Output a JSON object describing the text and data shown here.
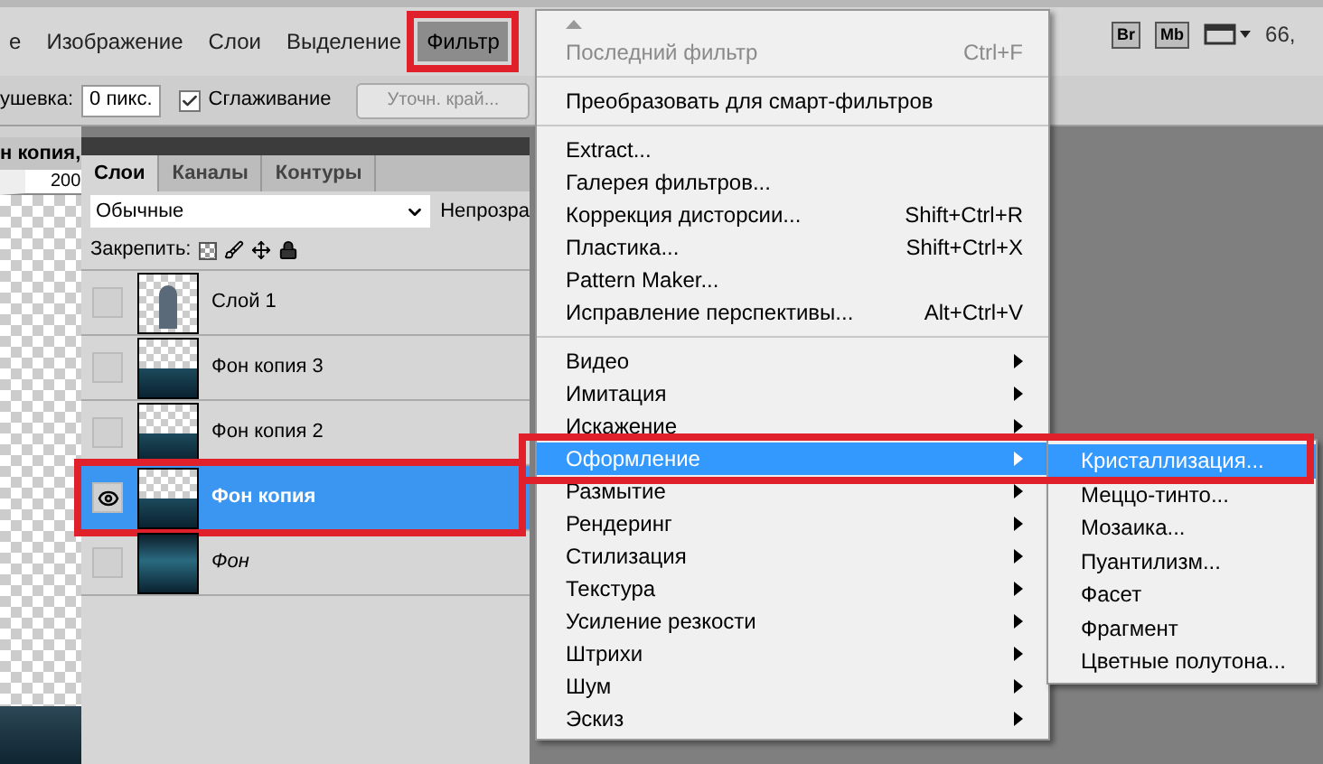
{
  "menubar": {
    "items": [
      {
        "label": "е",
        "selected": false
      },
      {
        "label": "Изображение",
        "selected": false
      },
      {
        "label": "Слои",
        "selected": false
      },
      {
        "label": "Выделение",
        "selected": false
      },
      {
        "label": "Фильтр",
        "selected": true
      }
    ],
    "app_buttons": [
      "Br",
      "Mb"
    ],
    "zoom": "66,"
  },
  "options_bar": {
    "feather_label": "ушевка:",
    "feather_value": "0 пикс.",
    "antialias": {
      "label": "Сглаживание",
      "checked": true
    },
    "refine_button": "Уточн. край..."
  },
  "document": {
    "tab": "н копия,",
    "ruler_mark": "200"
  },
  "layers_panel": {
    "tabs": [
      {
        "label": "Слои",
        "selected": true
      },
      {
        "label": "Каналы",
        "selected": false
      },
      {
        "label": "Контуры",
        "selected": false
      }
    ],
    "blend_mode": "Обычные",
    "opacity_label": "Непрозра",
    "lock_label": "Закрепить:",
    "layers": [
      {
        "name": "Слой 1",
        "kind": "figure",
        "visible": false,
        "selected": false
      },
      {
        "name": "Фон копия 3",
        "kind": "copy",
        "visible": false,
        "selected": false
      },
      {
        "name": "Фон копия 2",
        "kind": "copy",
        "visible": false,
        "selected": false
      },
      {
        "name": "Фон копия",
        "kind": "copy",
        "visible": true,
        "selected": true
      },
      {
        "name": "Фон",
        "kind": "background",
        "visible": false,
        "selected": false
      }
    ]
  },
  "filter_menu": {
    "sections": [
      [
        {
          "label": "Последний фильтр",
          "shortcut": "Ctrl+F",
          "disabled": true,
          "submenu": false,
          "selected": false
        }
      ],
      [
        {
          "label": "Преобразовать для смарт-фильтров",
          "disabled": false,
          "submenu": false,
          "selected": false
        }
      ],
      [
        {
          "label": "Extract...",
          "disabled": false,
          "submenu": false,
          "selected": false
        },
        {
          "label": "Галерея фильтров...",
          "disabled": false,
          "submenu": false,
          "selected": false
        },
        {
          "label": "Коррекция дисторсии...",
          "shortcut": "Shift+Ctrl+R",
          "disabled": false,
          "submenu": false,
          "selected": false
        },
        {
          "label": "Пластика...",
          "shortcut": "Shift+Ctrl+X",
          "disabled": false,
          "submenu": false,
          "selected": false
        },
        {
          "label": "Pattern Maker...",
          "disabled": false,
          "submenu": false,
          "selected": false
        },
        {
          "label": "Исправление перспективы...",
          "shortcut": "Alt+Ctrl+V",
          "disabled": false,
          "submenu": false,
          "selected": false
        }
      ],
      [
        {
          "label": "Видео",
          "disabled": false,
          "submenu": true,
          "selected": false
        },
        {
          "label": "Имитация",
          "disabled": false,
          "submenu": true,
          "selected": false
        },
        {
          "label": "Искажение",
          "disabled": false,
          "submenu": true,
          "selected": false
        },
        {
          "label": "Оформление",
          "disabled": false,
          "submenu": true,
          "selected": true
        },
        {
          "label": "Размытие",
          "disabled": false,
          "submenu": true,
          "selected": false
        },
        {
          "label": "Рендеринг",
          "disabled": false,
          "submenu": true,
          "selected": false
        },
        {
          "label": "Стилизация",
          "disabled": false,
          "submenu": true,
          "selected": false
        },
        {
          "label": "Текстура",
          "disabled": false,
          "submenu": true,
          "selected": false
        },
        {
          "label": "Усиление резкости",
          "disabled": false,
          "submenu": true,
          "selected": false
        },
        {
          "label": "Штрихи",
          "disabled": false,
          "submenu": true,
          "selected": false
        },
        {
          "label": "Шум",
          "disabled": false,
          "submenu": true,
          "selected": false
        },
        {
          "label": "Эскиз",
          "disabled": false,
          "submenu": true,
          "selected": false
        }
      ]
    ]
  },
  "submenu": {
    "items": [
      {
        "label": "Кристаллизация...",
        "selected": true
      },
      {
        "label": "Меццо-тинто...",
        "selected": false
      },
      {
        "label": "Мозаика...",
        "selected": false
      },
      {
        "label": "Пуантилизм...",
        "selected": false
      },
      {
        "label": "Фасет",
        "selected": false
      },
      {
        "label": "Фрагмент",
        "selected": false
      },
      {
        "label": "Цветные полутона...",
        "selected": false
      }
    ]
  }
}
